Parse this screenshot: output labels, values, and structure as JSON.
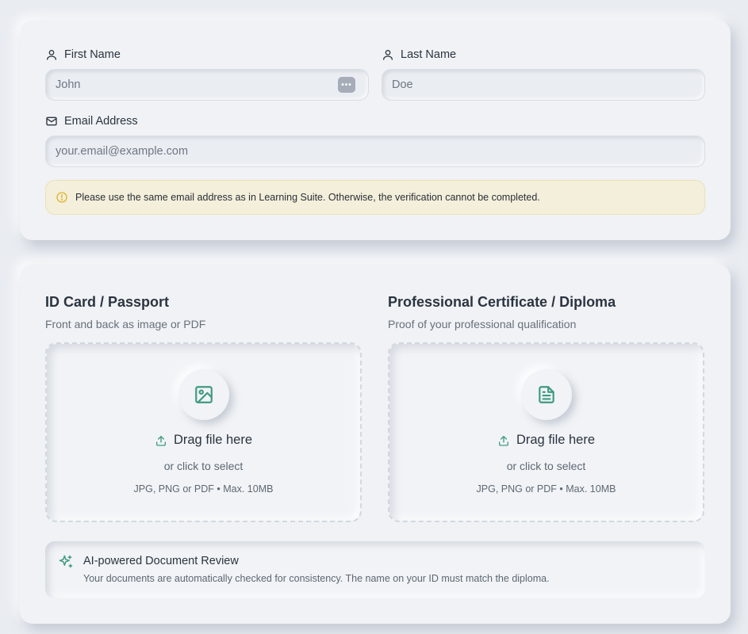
{
  "personal": {
    "first_name": {
      "label": "First Name",
      "placeholder": "John",
      "icon": "user-icon"
    },
    "last_name": {
      "label": "Last Name",
      "placeholder": "Doe",
      "icon": "user-icon"
    },
    "email": {
      "label": "Email Address",
      "placeholder": "your.email@example.com",
      "icon": "mail-icon"
    },
    "notice": {
      "text": "Please use the same email address as in Learning Suite. Otherwise, the verification cannot be completed.",
      "icon": "alert-circle-icon"
    }
  },
  "documents": {
    "id_card": {
      "title": "ID Card / Passport",
      "subtitle": "Front and back as image or PDF",
      "icon": "image-icon",
      "drop_label": "Drag file here",
      "or_label": "or click to select",
      "formats": "JPG, PNG or PDF • Max. 10MB"
    },
    "certificate": {
      "title": "Professional Certificate / Diploma",
      "subtitle": "Proof of your professional qualification",
      "icon": "file-text-icon",
      "drop_label": "Drag file here",
      "or_label": "or click to select",
      "formats": "JPG, PNG or PDF • Max. 10MB"
    },
    "ai_review": {
      "title": "AI-powered Document Review",
      "text": "Your documents are automatically checked for consistency. The name on your ID must match the diploma.",
      "icon": "sparkles-icon"
    }
  },
  "colors": {
    "accent": "#3f9a80",
    "warning": "#e0b32a",
    "notice_bg": "#f3efdb"
  }
}
